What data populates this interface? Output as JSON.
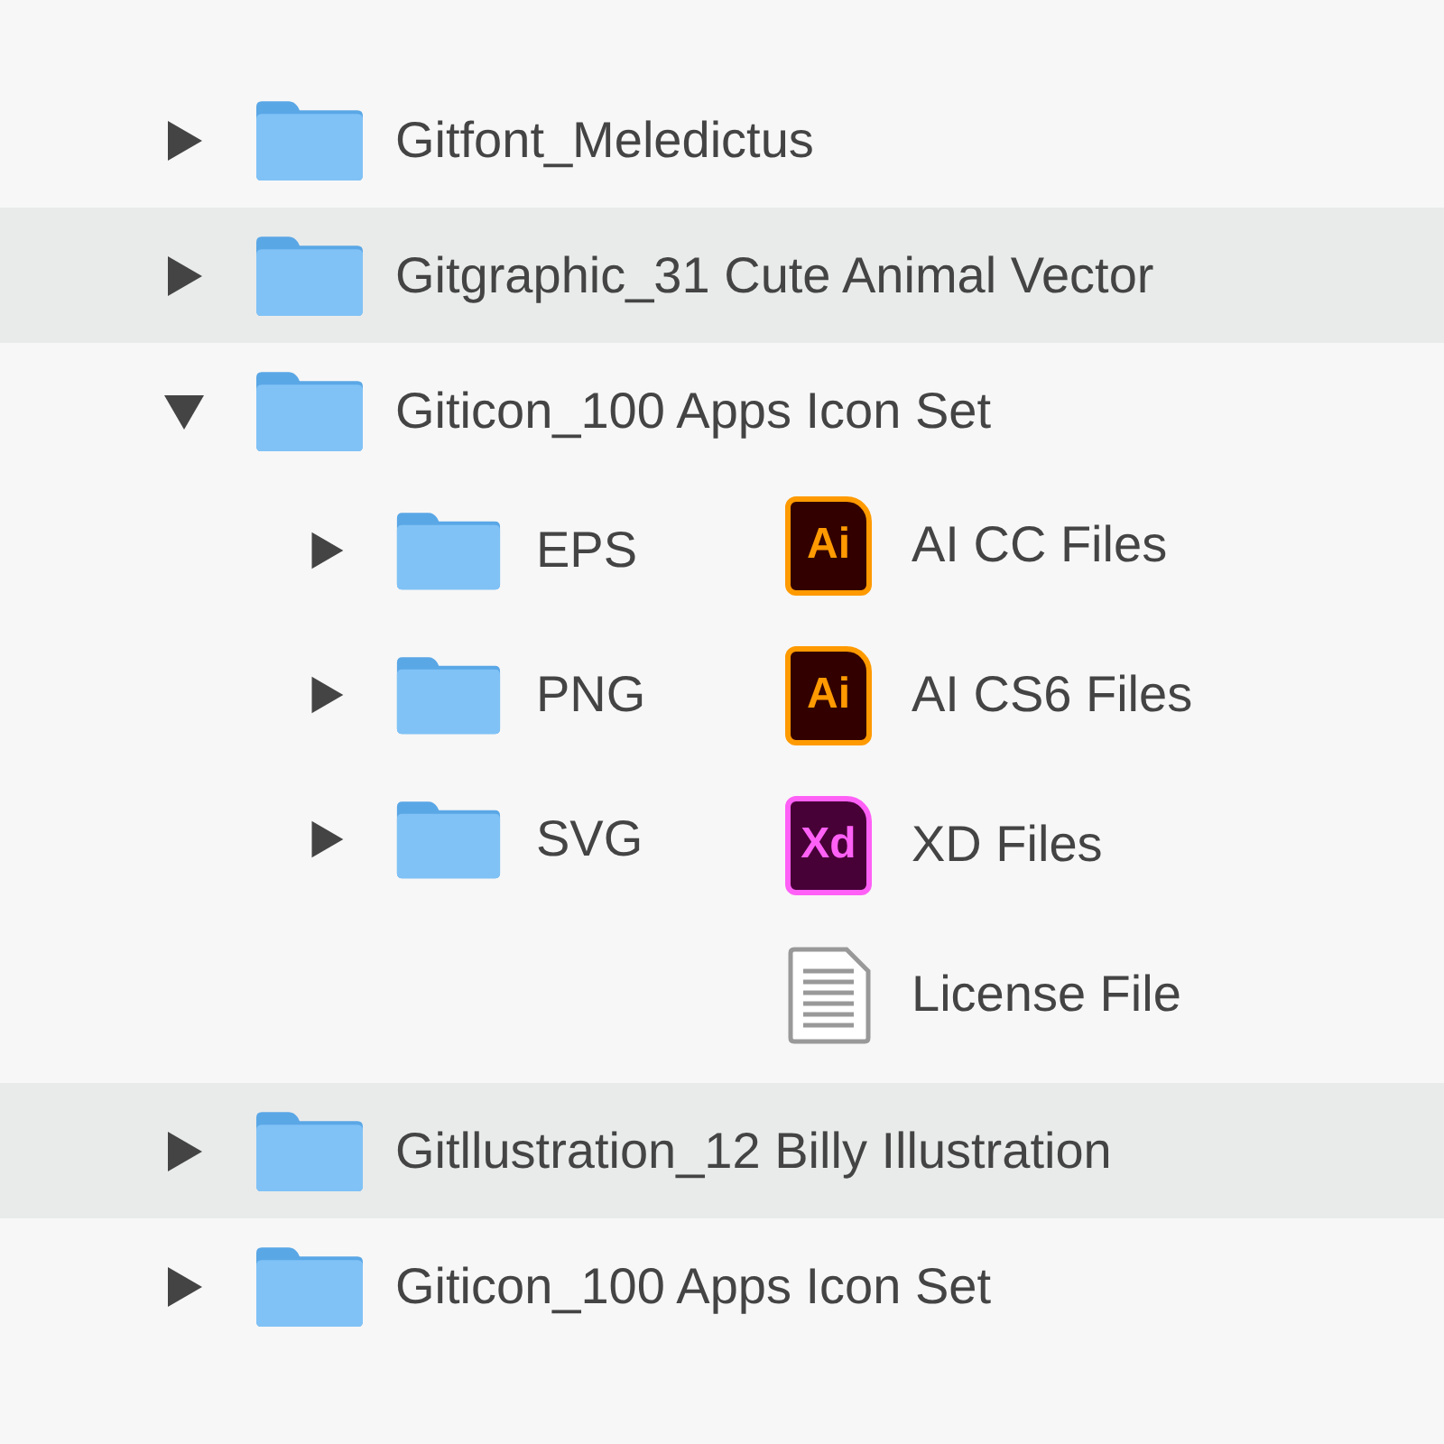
{
  "items": [
    {
      "name": "Gitfont_Meledictus",
      "expanded": false,
      "selected": false
    },
    {
      "name": "Gitgraphic_31 Cute Animal Vector",
      "expanded": false,
      "selected": true
    },
    {
      "name": "Giticon_100 Apps Icon Set",
      "expanded": true,
      "selected": false,
      "folders": [
        {
          "name": "EPS",
          "expanded": false
        },
        {
          "name": "PNG",
          "expanded": false
        },
        {
          "name": "SVG",
          "expanded": false
        }
      ],
      "files": [
        {
          "name": "AI CC Files",
          "kind": "ai",
          "badge": "Ai"
        },
        {
          "name": "AI CS6 Files",
          "kind": "ai",
          "badge": "Ai"
        },
        {
          "name": "XD Files",
          "kind": "xd",
          "badge": "Xd"
        },
        {
          "name": "License File",
          "kind": "text"
        }
      ]
    },
    {
      "name": "Gitllustration_12 Billy Illustration",
      "expanded": false,
      "selected": true
    },
    {
      "name": "Giticon_100 Apps Icon Set",
      "expanded": false,
      "selected": false
    }
  ]
}
